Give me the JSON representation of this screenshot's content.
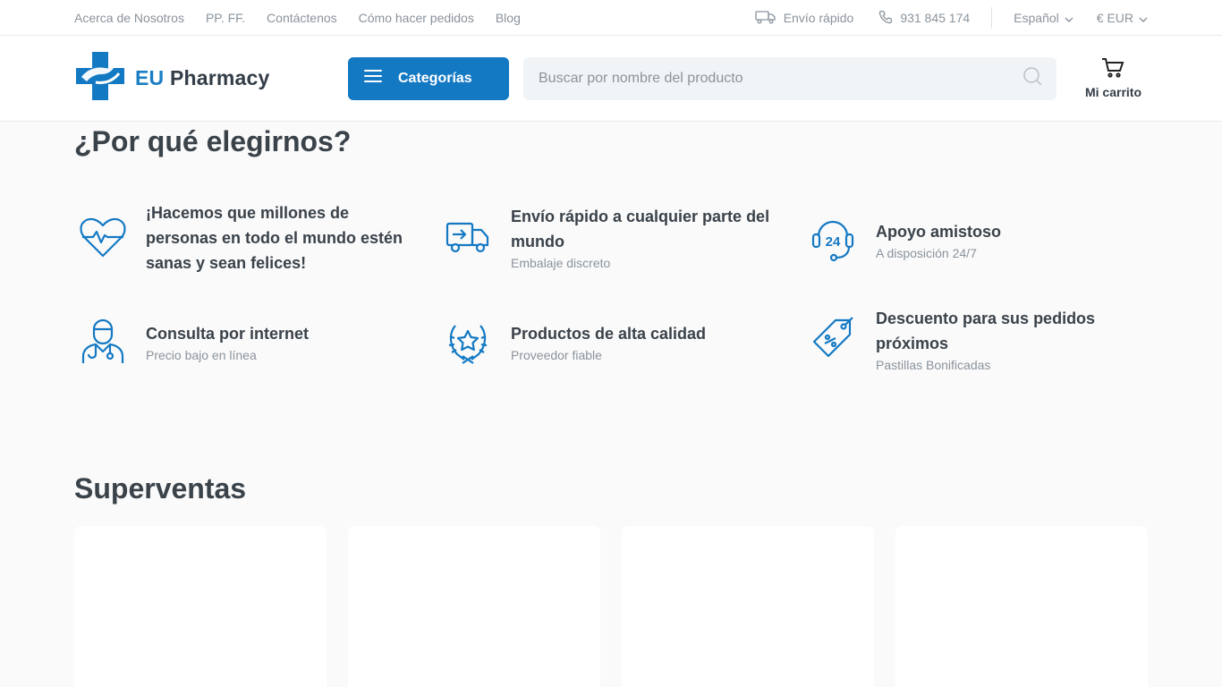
{
  "topbar": {
    "links": [
      "Acerca de Nosotros",
      "PP. FF.",
      "Contáctenos",
      "Cómo hacer pedidos",
      "Blog"
    ],
    "shipping": "Envío rápido",
    "phone": "931 845 174",
    "language": "Español",
    "currency": "€ EUR"
  },
  "header": {
    "logo_eu": "EU",
    "logo_name": "Pharmacy",
    "categories_label": "Categorías",
    "search_placeholder": "Buscar por nombre del producto",
    "cart_label": "Mi carrito"
  },
  "why": {
    "title": "¿Por qué elegirnos?",
    "features": [
      {
        "icon": "heart-pulse-icon",
        "title": "¡Hacemos que millones de personas en todo el mundo estén sanas y sean felices!",
        "subtitle": ""
      },
      {
        "icon": "delivery-truck-icon",
        "title": "Envío rápido a cualquier parte del mundo",
        "subtitle": "Embalaje discreto"
      },
      {
        "icon": "support-24-icon",
        "title": "Apoyo amistoso",
        "subtitle": "A disposición 24/7"
      },
      {
        "icon": "doctor-icon",
        "title": "Consulta por internet",
        "subtitle": "Precio bajo en línea"
      },
      {
        "icon": "laurel-star-icon",
        "title": "Productos de alta calidad",
        "subtitle": "Proveedor fiable"
      },
      {
        "icon": "discount-tag-icon",
        "title": "Descuento para sus pedidos próximos",
        "subtitle": "Pastillas Bonificadas"
      }
    ]
  },
  "bestsellers": {
    "title": "Superventas"
  },
  "colors": {
    "accent": "#1479c3",
    "text": "#333d47",
    "muted": "#8a939c"
  }
}
